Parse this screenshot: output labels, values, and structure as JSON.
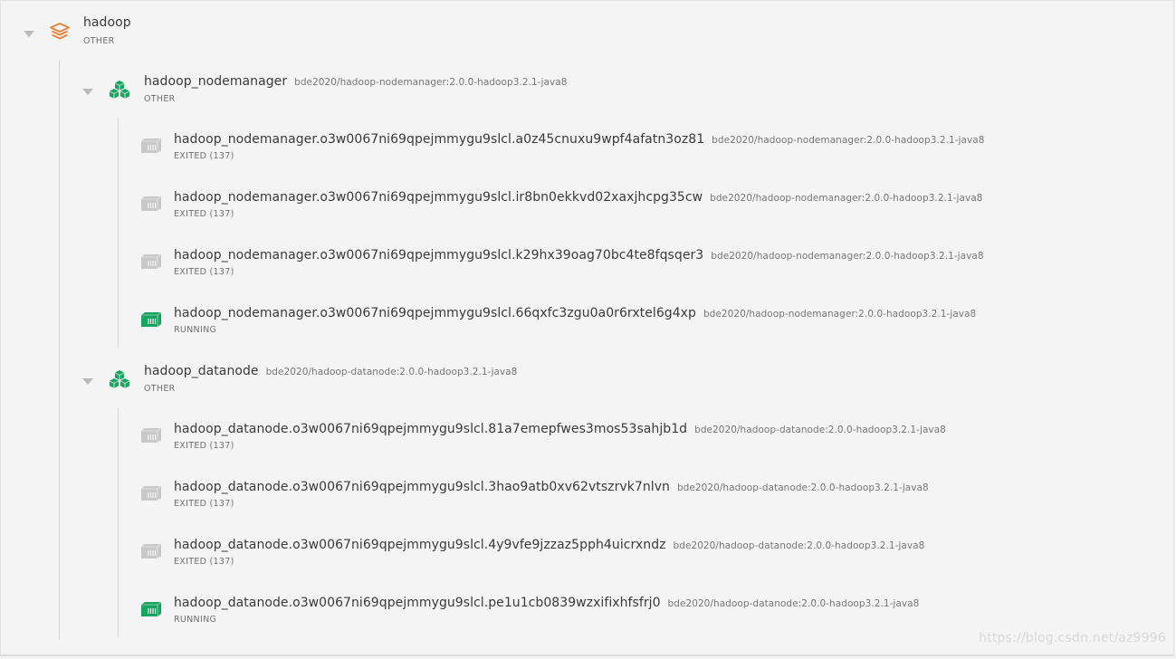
{
  "stack": {
    "name": "hadoop",
    "status": "OTHER",
    "icon": "layers-icon",
    "accent": "#e8833a"
  },
  "services": [
    {
      "name": "hadoop_nodemanager",
      "image": "bde2020/hadoop-nodemanager:2.0.0-hadoop3.2.1-java8",
      "status": "OTHER",
      "icon": "cubes-icon",
      "containers": [
        {
          "name": "hadoop_nodemanager.o3w0067ni69qpejmmygu9slcl.a0z45cnuxu9wpf4afatn3oz81",
          "image": "bde2020/hadoop-nodemanager:2.0.0-hadoop3.2.1-java8",
          "status": "EXITED (137)",
          "running": false
        },
        {
          "name": "hadoop_nodemanager.o3w0067ni69qpejmmygu9slcl.ir8bn0ekkvd02xaxjhcpg35cw",
          "image": "bde2020/hadoop-nodemanager:2.0.0-hadoop3.2.1-java8",
          "status": "EXITED (137)",
          "running": false
        },
        {
          "name": "hadoop_nodemanager.o3w0067ni69qpejmmygu9slcl.k29hx39oag70bc4te8fqsqer3",
          "image": "bde2020/hadoop-nodemanager:2.0.0-hadoop3.2.1-java8",
          "status": "EXITED (137)",
          "running": false
        },
        {
          "name": "hadoop_nodemanager.o3w0067ni69qpejmmygu9slcl.66qxfc3zgu0a0r6rxtel6g4xp",
          "image": "bde2020/hadoop-nodemanager:2.0.0-hadoop3.2.1-java8",
          "status": "RUNNING",
          "running": true
        }
      ]
    },
    {
      "name": "hadoop_datanode",
      "image": "bde2020/hadoop-datanode:2.0.0-hadoop3.2.1-java8",
      "status": "OTHER",
      "icon": "cubes-icon",
      "containers": [
        {
          "name": "hadoop_datanode.o3w0067ni69qpejmmygu9slcl.81a7emepfwes3mos53sahjb1d",
          "image": "bde2020/hadoop-datanode:2.0.0-hadoop3.2.1-java8",
          "status": "EXITED (137)",
          "running": false
        },
        {
          "name": "hadoop_datanode.o3w0067ni69qpejmmygu9slcl.3hao9atb0xv62vtszrvk7nlvn",
          "image": "bde2020/hadoop-datanode:2.0.0-hadoop3.2.1-java8",
          "status": "EXITED (137)",
          "running": false
        },
        {
          "name": "hadoop_datanode.o3w0067ni69qpejmmygu9slcl.4y9vfe9jzzaz5pph4uicrxndz",
          "image": "bde2020/hadoop-datanode:2.0.0-hadoop3.2.1-java8",
          "status": "EXITED (137)",
          "running": false
        },
        {
          "name": "hadoop_datanode.o3w0067ni69qpejmmygu9slcl.pe1u1cb0839wzxifixhfsfrj0",
          "image": "bde2020/hadoop-datanode:2.0.0-hadoop3.2.1-java8",
          "status": "RUNNING",
          "running": true
        }
      ]
    }
  ],
  "colors": {
    "running": "#1aa260",
    "exited": "#c8c8c8",
    "service": "#1aa260"
  },
  "watermark": "https://blog.csdn.net/az9996"
}
